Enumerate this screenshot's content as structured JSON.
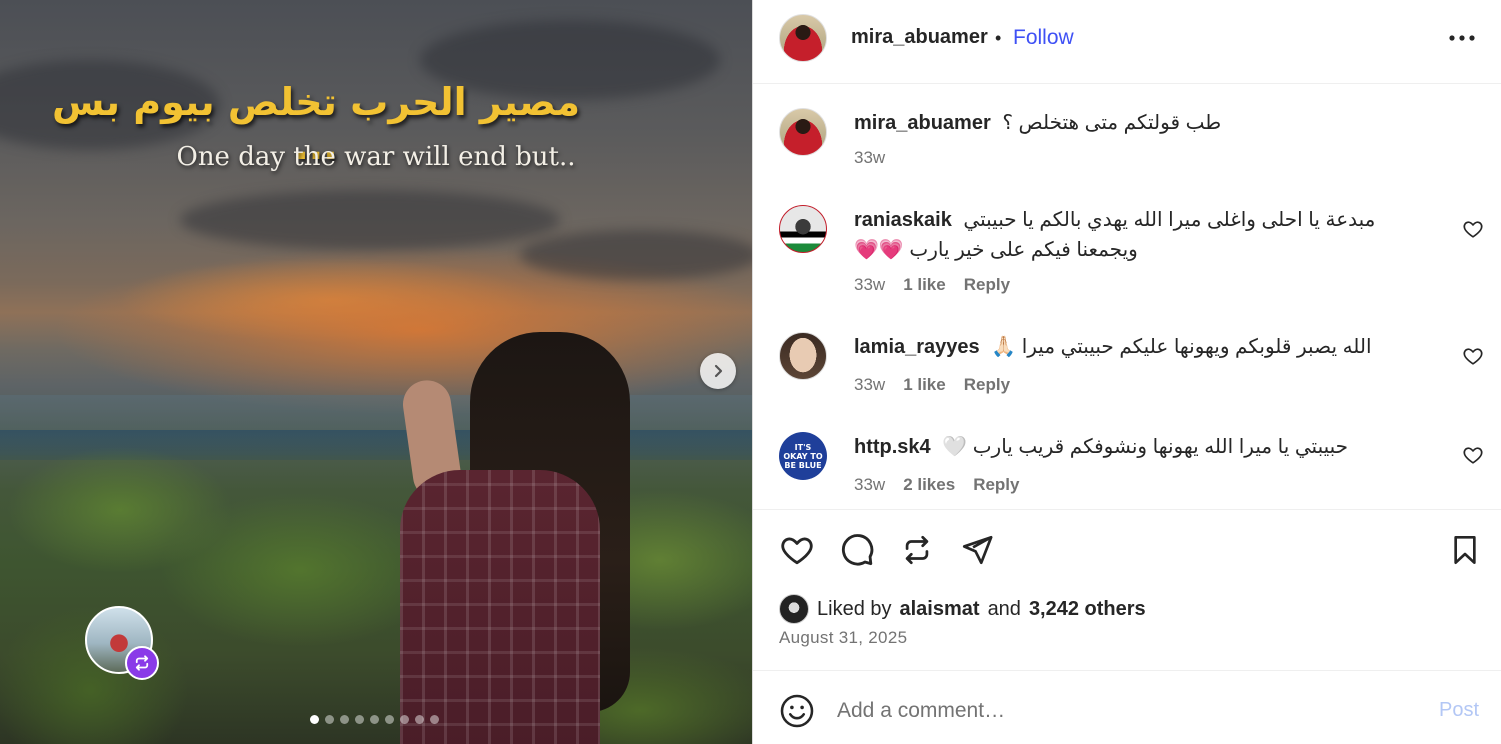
{
  "media": {
    "overlay_arabic": "مصير الحرب تخلص بيوم بس ...",
    "overlay_english": "One day the war will end but..",
    "carousel_dots": 9,
    "active_dot": 0,
    "next_icon": "chevron-right-icon",
    "collab_badge_icon": "repost-icon"
  },
  "header": {
    "username": "mira_abuamer",
    "separator": "•",
    "follow_label": "Follow",
    "more_icon": "more-horizontal-icon"
  },
  "caption": {
    "username": "mira_abuamer",
    "text": "طب قولتكم متى هتخلص ؟",
    "time": "33w"
  },
  "comments": [
    {
      "username": "raniaskaik",
      "text": "مبدعة يا احلى واغلى ميرا الله يهدي بالكم يا حبيبتي ويجمعنا فيكم على خير يارب 💗💗",
      "time": "33w",
      "likes": "1 like",
      "reply": "Reply"
    },
    {
      "username": "lamia_rayyes",
      "text": "الله يصبر قلوبكم ويهونها عليكم حبيبتي ميرا 🙏🏻",
      "time": "33w",
      "likes": "1 like",
      "reply": "Reply"
    },
    {
      "username": "http.sk4",
      "text": "حبيبتي يا ميرا الله يهونها ونشوفكم قريب يارب 🤍",
      "time": "33w",
      "likes": "2 likes",
      "reply": "Reply",
      "avatar_text": "IT'S OKAY TO BE BLUE"
    }
  ],
  "actions": {
    "like_icon": "heart-icon",
    "comment_icon": "comment-icon",
    "repost_icon": "repost-icon",
    "share_icon": "send-icon",
    "save_icon": "bookmark-icon"
  },
  "likes": {
    "prefix": "Liked by",
    "liker": "alaismat",
    "and": "and",
    "others": "3,242 others"
  },
  "date": "August 31, 2025",
  "add_comment": {
    "placeholder": "Add a comment…",
    "post_label": "Post",
    "emoji_icon": "emoji-smile-icon"
  },
  "colors": {
    "follow": "#3f51f5",
    "post_disabled": "#b3c7f5",
    "overlay_arabic": "#f2c233",
    "muted": "#737373"
  }
}
